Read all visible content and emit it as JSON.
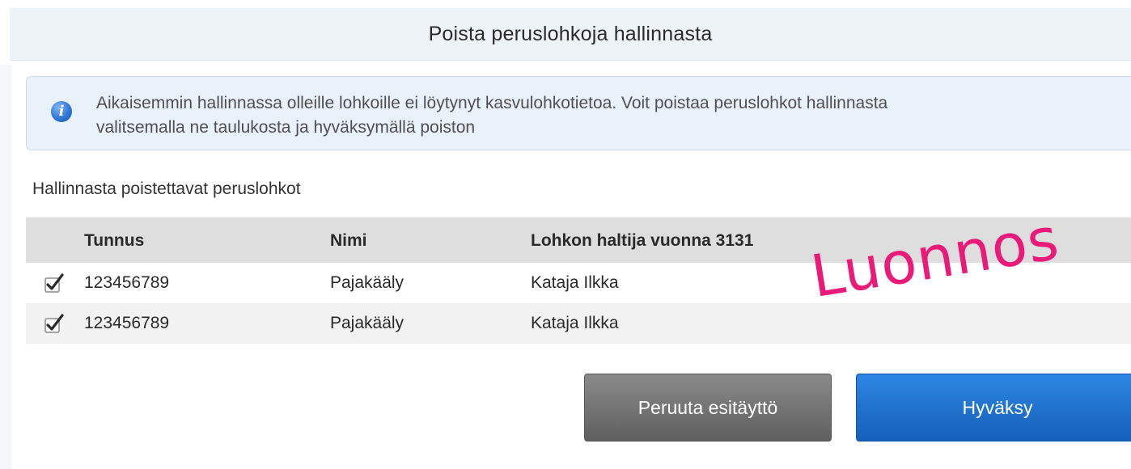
{
  "dialog": {
    "title": "Poista peruslohkoja hallinnasta"
  },
  "info": {
    "icon": "info-icon",
    "line1": "Aikaisemmin hallinnassa olleille lohkoille ei löytynyt kasvulohkotietoa. Voit poistaa peruslohkot hallinnasta",
    "line2": "valitsemalla ne taulukosta ja hyväksymällä poiston"
  },
  "section": {
    "label": "Hallinnasta poistettavat peruslohkot"
  },
  "table": {
    "columns": [
      "Tunnus",
      "Nimi",
      "Lohkon haltija vuonna 3131"
    ],
    "rows": [
      {
        "checked": true,
        "tunnus": "123456789",
        "nimi": "Pajakääly",
        "haltija": "Kataja Ilkka"
      },
      {
        "checked": true,
        "tunnus": "123456789",
        "nimi": "Pajakääly",
        "haltija": "Kataja Ilkka"
      }
    ]
  },
  "watermark": "Luonnos",
  "buttons": {
    "cancel": "Peruuta esitäyttö",
    "accept": "Hyväksy"
  },
  "colors": {
    "accent": "#1c6fd0",
    "watermark": "#ea1a78",
    "cancel_button": "#6f6f6f"
  }
}
